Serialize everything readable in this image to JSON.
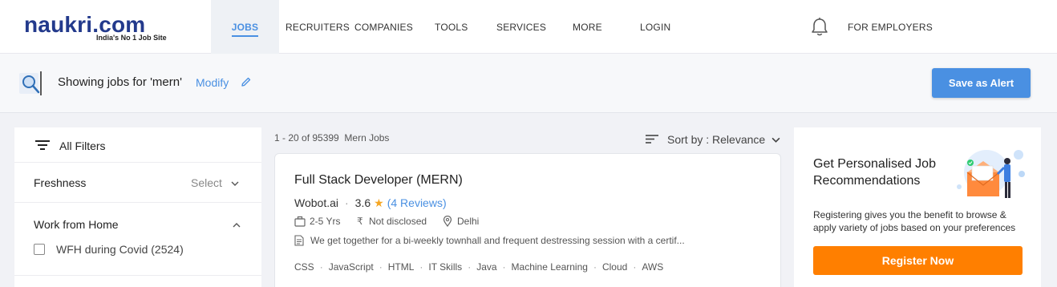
{
  "brand": {
    "name": "naukri.com",
    "tagline": "India's No 1 Job Site",
    "color": "#233a8c"
  },
  "nav": {
    "jobs": "JOBS",
    "recruiters": "RECRUITERS",
    "companies": "COMPANIES",
    "tools": "TOOLS",
    "services": "SERVICES",
    "more": "MORE",
    "login": "LOGIN",
    "for_employers": "FOR EMPLOYERS"
  },
  "search": {
    "showing_text": "Showing jobs for 'mern'",
    "modify": "Modify",
    "save_alert": "Save as Alert"
  },
  "filters": {
    "title": "All Filters",
    "freshness_label": "Freshness",
    "freshness_value": "Select",
    "wfh_title": "Work from Home",
    "wfh_option": "WFH during Covid",
    "wfh_count": "(2524)"
  },
  "results": {
    "count_text": "1 - 20 of 95399",
    "query_label": "Mern Jobs",
    "sort_text": "Sort by : Relevance"
  },
  "job": {
    "title": "Full Stack Developer (MERN)",
    "company": "Wobot.ai",
    "rating": "3.6",
    "reviews": "(4 Reviews)",
    "experience": "2-5 Yrs",
    "salary": "Not disclosed",
    "location": "Delhi",
    "description": "We get together for a bi-weekly townhall and frequent destressing session with a certif...",
    "tags": [
      "CSS",
      "JavaScript",
      "HTML",
      "IT Skills",
      "Java",
      "Machine Learning",
      "Cloud",
      "AWS"
    ]
  },
  "reco": {
    "title": "Get Personalised Job Recommendations",
    "text": "Registering gives you the benefit to browse & apply variety of jobs based on your preferences",
    "register": "Register Now"
  },
  "colors": {
    "accent": "#4a90e2",
    "register": "#ff7f00",
    "star": "#f5a623"
  }
}
